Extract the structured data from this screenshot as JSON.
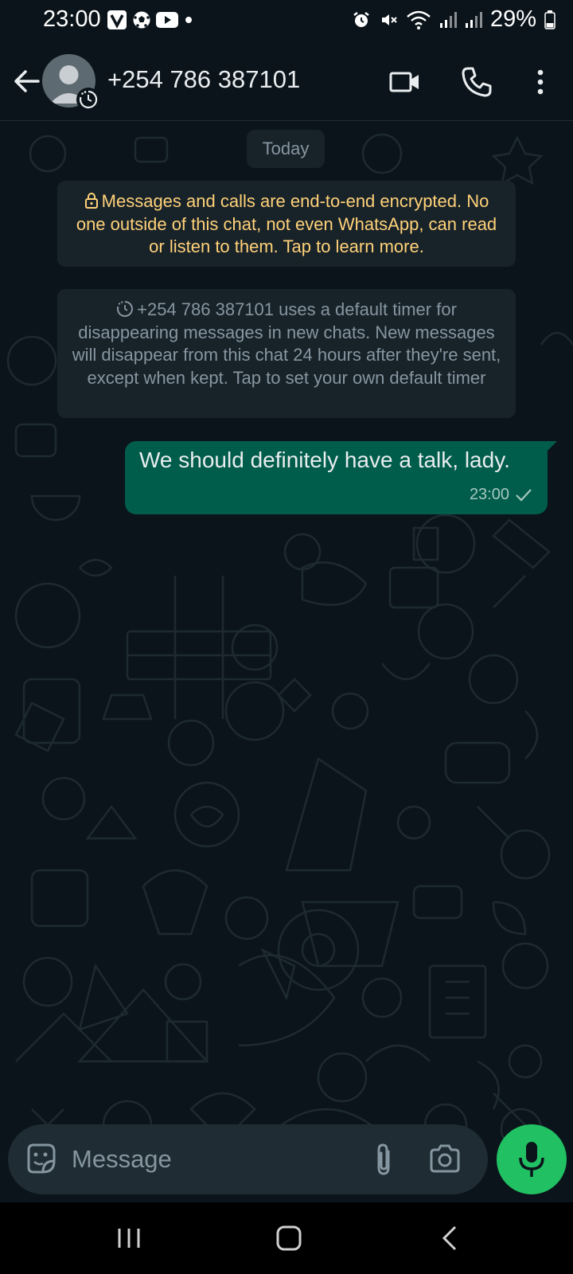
{
  "status_bar": {
    "time": "23:00",
    "battery": "29%",
    "left_icons": [
      "v-app-icon",
      "soccer-ball-icon",
      "youtube-icon",
      "notification-dot-icon"
    ],
    "right_icons": [
      "alarm-icon",
      "mute-icon",
      "wifi-icon",
      "signal-icon",
      "signal-icon",
      "battery-icon"
    ]
  },
  "header": {
    "contact_name": "+254 786 387101",
    "icons": [
      "back-arrow-icon",
      "video-call-icon",
      "phone-call-icon",
      "more-vert-icon"
    ]
  },
  "chat": {
    "date_chip": "Today",
    "encryption_notice": "Messages and calls are end-to-end encrypted. No one outside of this chat, not even WhatsApp, can read or listen to them. Tap to learn more.",
    "timer_notice": "+254 786 387101 uses a default timer for disappearing messages in new chats. New messages will disappear from this chat 24 hours after they're sent, except when kept. Tap to set your own default timer",
    "messages": [
      {
        "direction": "outgoing",
        "text": "We should definitely have a talk, lady.",
        "time": "23:00",
        "status": "sent"
      }
    ]
  },
  "composer": {
    "placeholder": "Message",
    "value": ""
  },
  "colors": {
    "background": "#0b141a",
    "bubble_outgoing": "#005c4b",
    "system_bubble": "#182229",
    "encryption_text": "#ffd279",
    "mic_button": "#21c063"
  }
}
